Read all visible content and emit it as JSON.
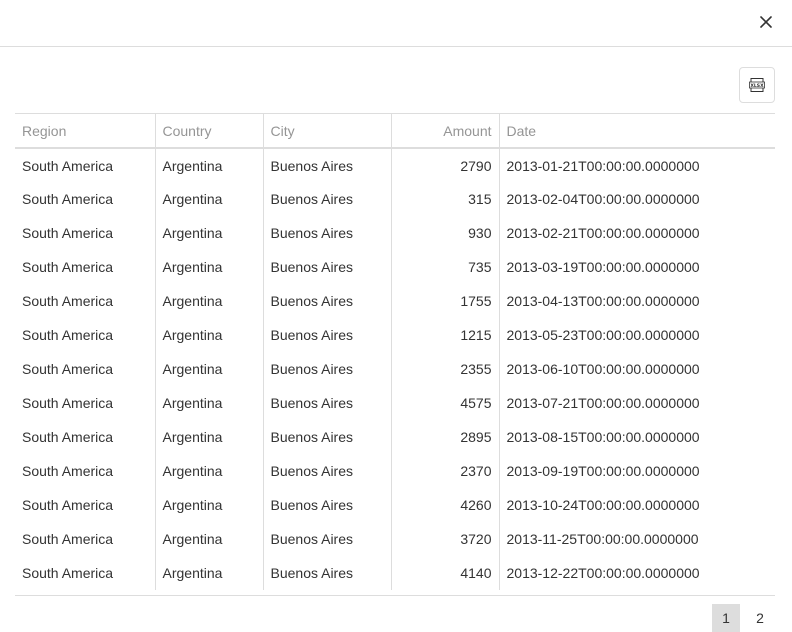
{
  "dialog": {
    "close_icon": "close-icon"
  },
  "toolbar": {
    "export_icon": "xlsx-export-icon",
    "export_glyph": "XLSX"
  },
  "grid": {
    "columns": [
      "Region",
      "Country",
      "City",
      "Amount",
      "Date"
    ],
    "rows": [
      [
        "South America",
        "Argentina",
        "Buenos Aires",
        "2790",
        "2013-01-21T00:00:00.0000000"
      ],
      [
        "South America",
        "Argentina",
        "Buenos Aires",
        "315",
        "2013-02-04T00:00:00.0000000"
      ],
      [
        "South America",
        "Argentina",
        "Buenos Aires",
        "930",
        "2013-02-21T00:00:00.0000000"
      ],
      [
        "South America",
        "Argentina",
        "Buenos Aires",
        "735",
        "2013-03-19T00:00:00.0000000"
      ],
      [
        "South America",
        "Argentina",
        "Buenos Aires",
        "1755",
        "2013-04-13T00:00:00.0000000"
      ],
      [
        "South America",
        "Argentina",
        "Buenos Aires",
        "1215",
        "2013-05-23T00:00:00.0000000"
      ],
      [
        "South America",
        "Argentina",
        "Buenos Aires",
        "2355",
        "2013-06-10T00:00:00.0000000"
      ],
      [
        "South America",
        "Argentina",
        "Buenos Aires",
        "4575",
        "2013-07-21T00:00:00.0000000"
      ],
      [
        "South America",
        "Argentina",
        "Buenos Aires",
        "2895",
        "2013-08-15T00:00:00.0000000"
      ],
      [
        "South America",
        "Argentina",
        "Buenos Aires",
        "2370",
        "2013-09-19T00:00:00.0000000"
      ],
      [
        "South America",
        "Argentina",
        "Buenos Aires",
        "4260",
        "2013-10-24T00:00:00.0000000"
      ],
      [
        "South America",
        "Argentina",
        "Buenos Aires",
        "3720",
        "2013-11-25T00:00:00.0000000"
      ],
      [
        "South America",
        "Argentina",
        "Buenos Aires",
        "4140",
        "2013-12-22T00:00:00.0000000"
      ]
    ]
  },
  "pager": {
    "pages": [
      "1",
      "2"
    ],
    "selected": "1"
  },
  "colors": {
    "border": "#dddddd",
    "header_text": "#959595",
    "cell_text": "#333333",
    "selected_page_bg": "#dddddd"
  }
}
